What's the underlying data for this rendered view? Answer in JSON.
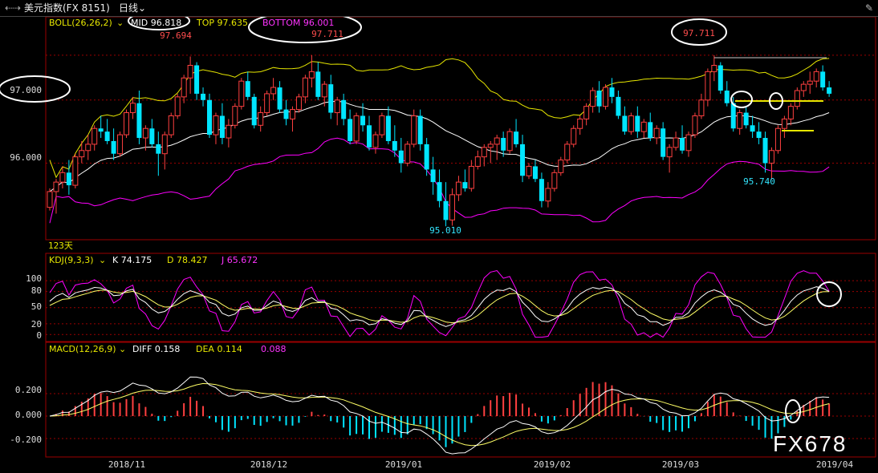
{
  "header": {
    "nav_icon": "back-forward-icon",
    "instrument": "美元指数(FX 8151)",
    "period": "日线",
    "gear_icon": "wrench-icon"
  },
  "price_panel": {
    "boll_label": "BOLL(26,26,2)",
    "mid_label": "MID 96.818",
    "top_label": "TOP 97.635",
    "bottom_label": "BOTTOM 96.001",
    "yticks": [
      "97.000",
      "96.000"
    ],
    "ann_left_high": "97.694",
    "ann_mid_high": "97.711",
    "ann_right_high": "97.711",
    "ann_low1": "95.010",
    "ann_low2": "95.740",
    "days_label": "123天"
  },
  "kdj_panel": {
    "label": "KDJ(9,3,3)",
    "k_label": "K 74.175",
    "d_label": "D 78.427",
    "j_label": "J 65.672",
    "yticks": [
      "100",
      "80",
      "50",
      "20",
      "0"
    ]
  },
  "macd_panel": {
    "label": "MACD(12,26,9)",
    "diff_label": "DIFF 0.158",
    "dea_label": "DEA 0.114",
    "hist_label": "0.088",
    "yticks": [
      "0.200",
      "0.000",
      "-0.200"
    ]
  },
  "x_axis": {
    "labels": [
      "2018/11",
      "2018/12",
      "2019/01",
      "2019/02",
      "2019/03",
      "2019/04"
    ]
  },
  "watermark": "FX678",
  "colors": {
    "up": "#ff4040",
    "down": "#00e5ff",
    "mid": "#ffffff",
    "top": "#e6e600",
    "bottom": "#ff00ff",
    "grid": "#800000",
    "kdj_k": "#ffffff",
    "kdj_d": "#ffff66",
    "kdj_j": "#ff00ff"
  },
  "chart_data": {
    "type": "candlestick",
    "title": "美元指数(FX 8151) 日线",
    "price_ylim": [
      94.8,
      97.95
    ],
    "candles": [
      [
        95.3,
        95.6,
        95.25,
        95.55
      ],
      [
        95.55,
        95.75,
        95.2,
        95.7
      ],
      [
        95.7,
        95.95,
        95.6,
        95.85
      ],
      [
        95.85,
        96.05,
        95.5,
        95.65
      ],
      [
        95.65,
        96.15,
        95.6,
        96.1
      ],
      [
        96.1,
        96.35,
        96.0,
        96.2
      ],
      [
        96.2,
        96.45,
        96.05,
        96.3
      ],
      [
        96.3,
        96.6,
        96.2,
        96.55
      ],
      [
        96.55,
        96.75,
        96.4,
        96.5
      ],
      [
        96.5,
        96.7,
        96.3,
        96.35
      ],
      [
        96.35,
        96.55,
        96.05,
        96.15
      ],
      [
        96.15,
        96.5,
        96.1,
        96.45
      ],
      [
        96.45,
        96.85,
        96.4,
        96.8
      ],
      [
        96.8,
        97.05,
        96.7,
        96.95
      ],
      [
        96.95,
        97.15,
        96.3,
        96.4
      ],
      [
        96.4,
        96.6,
        96.2,
        96.55
      ],
      [
        96.55,
        96.7,
        96.25,
        96.3
      ],
      [
        96.3,
        96.5,
        95.8,
        96.15
      ],
      [
        96.15,
        96.5,
        95.9,
        96.45
      ],
      [
        96.45,
        96.8,
        96.4,
        96.75
      ],
      [
        96.75,
        97.1,
        96.7,
        97.05
      ],
      [
        97.05,
        97.4,
        96.95,
        97.35
      ],
      [
        97.35,
        97.69,
        97.1,
        97.55
      ],
      [
        97.55,
        97.6,
        97.0,
        97.1
      ],
      [
        97.1,
        97.2,
        96.9,
        97.0
      ],
      [
        97.0,
        97.1,
        96.4,
        96.45
      ],
      [
        96.45,
        96.8,
        96.3,
        96.75
      ],
      [
        96.75,
        96.95,
        96.3,
        96.4
      ],
      [
        96.4,
        96.7,
        96.25,
        96.6
      ],
      [
        96.6,
        96.95,
        96.55,
        96.9
      ],
      [
        96.9,
        97.35,
        96.85,
        97.3
      ],
      [
        97.3,
        97.45,
        97.0,
        97.05
      ],
      [
        97.05,
        97.1,
        96.55,
        96.6
      ],
      [
        96.6,
        96.9,
        96.5,
        96.8
      ],
      [
        96.8,
        97.15,
        96.75,
        97.1
      ],
      [
        97.1,
        97.35,
        97.0,
        97.2
      ],
      [
        97.2,
        97.3,
        96.8,
        96.85
      ],
      [
        96.85,
        97.0,
        96.6,
        96.7
      ],
      [
        96.7,
        96.9,
        96.5,
        96.85
      ],
      [
        96.85,
        97.1,
        96.8,
        97.05
      ],
      [
        97.05,
        97.4,
        96.95,
        97.35
      ],
      [
        97.35,
        97.71,
        97.2,
        97.45
      ],
      [
        97.45,
        97.6,
        97.0,
        97.05
      ],
      [
        97.05,
        97.3,
        96.9,
        97.25
      ],
      [
        97.25,
        97.4,
        96.7,
        96.8
      ],
      [
        96.8,
        97.05,
        96.6,
        97.0
      ],
      [
        97.0,
        97.1,
        96.6,
        96.7
      ],
      [
        96.7,
        96.85,
        96.3,
        96.35
      ],
      [
        96.35,
        96.8,
        96.3,
        96.75
      ],
      [
        96.75,
        96.95,
        96.5,
        96.6
      ],
      [
        96.6,
        96.75,
        96.2,
        96.25
      ],
      [
        96.25,
        96.5,
        96.15,
        96.45
      ],
      [
        96.45,
        96.8,
        96.4,
        96.75
      ],
      [
        96.75,
        96.9,
        96.3,
        96.35
      ],
      [
        96.35,
        96.6,
        96.1,
        96.2
      ],
      [
        96.2,
        96.4,
        95.85,
        96.0
      ],
      [
        96.0,
        96.35,
        95.95,
        96.3
      ],
      [
        96.3,
        96.85,
        96.25,
        96.75
      ],
      [
        96.75,
        96.85,
        96.2,
        96.3
      ],
      [
        96.3,
        96.4,
        95.8,
        95.9
      ],
      [
        95.9,
        96.1,
        95.5,
        95.7
      ],
      [
        95.7,
        95.9,
        95.3,
        95.4
      ],
      [
        95.4,
        95.7,
        95.0,
        95.1
      ],
      [
        95.1,
        95.6,
        95.01,
        95.5
      ],
      [
        95.5,
        95.8,
        95.4,
        95.7
      ],
      [
        95.7,
        95.9,
        95.55,
        95.6
      ],
      [
        95.6,
        96.05,
        95.55,
        95.95
      ],
      [
        95.95,
        96.2,
        95.9,
        96.1
      ],
      [
        96.1,
        96.3,
        95.95,
        96.25
      ],
      [
        96.25,
        96.35,
        96.0,
        96.3
      ],
      [
        96.3,
        96.45,
        96.05,
        96.4
      ],
      [
        96.4,
        96.5,
        96.1,
        96.2
      ],
      [
        96.2,
        96.55,
        96.15,
        96.5
      ],
      [
        96.5,
        96.7,
        96.25,
        96.3
      ],
      [
        96.3,
        96.45,
        95.7,
        95.8
      ],
      [
        95.8,
        96.0,
        95.75,
        95.95
      ],
      [
        95.95,
        96.05,
        95.7,
        95.75
      ],
      [
        95.75,
        95.85,
        95.3,
        95.4
      ],
      [
        95.4,
        95.7,
        95.3,
        95.6
      ],
      [
        95.6,
        95.9,
        95.55,
        95.85
      ],
      [
        95.85,
        96.1,
        95.8,
        96.05
      ],
      [
        96.05,
        96.35,
        96.0,
        96.3
      ],
      [
        96.3,
        96.6,
        96.25,
        96.55
      ],
      [
        96.55,
        96.75,
        96.45,
        96.7
      ],
      [
        96.7,
        96.95,
        96.6,
        96.9
      ],
      [
        96.9,
        97.2,
        96.8,
        97.15
      ],
      [
        97.15,
        97.3,
        96.8,
        96.9
      ],
      [
        96.9,
        97.25,
        96.85,
        97.2
      ],
      [
        97.2,
        97.35,
        96.95,
        97.05
      ],
      [
        97.05,
        97.15,
        96.7,
        96.75
      ],
      [
        96.75,
        96.9,
        96.45,
        96.5
      ],
      [
        96.5,
        96.8,
        96.45,
        96.75
      ],
      [
        96.75,
        96.9,
        96.4,
        96.5
      ],
      [
        96.5,
        96.7,
        96.4,
        96.65
      ],
      [
        96.65,
        96.8,
        96.35,
        96.4
      ],
      [
        96.4,
        96.6,
        96.3,
        96.55
      ],
      [
        96.55,
        96.65,
        96.05,
        96.1
      ],
      [
        96.1,
        96.3,
        95.85,
        96.25
      ],
      [
        96.25,
        96.5,
        96.2,
        96.4
      ],
      [
        96.4,
        96.6,
        96.15,
        96.2
      ],
      [
        96.2,
        96.5,
        96.1,
        96.45
      ],
      [
        96.45,
        96.8,
        96.4,
        96.75
      ],
      [
        96.75,
        97.1,
        96.7,
        97.0
      ],
      [
        97.0,
        97.5,
        96.9,
        97.45
      ],
      [
        97.45,
        97.71,
        97.3,
        97.55
      ],
      [
        97.55,
        97.6,
        97.1,
        97.15
      ],
      [
        97.15,
        97.3,
        96.9,
        96.95
      ],
      [
        96.95,
        97.05,
        96.5,
        96.55
      ],
      [
        96.55,
        96.85,
        96.45,
        96.8
      ],
      [
        96.8,
        96.9,
        96.55,
        96.6
      ],
      [
        96.6,
        96.75,
        96.4,
        96.5
      ],
      [
        96.5,
        96.65,
        96.3,
        96.4
      ],
      [
        96.4,
        96.5,
        95.85,
        96.0
      ],
      [
        96.0,
        96.25,
        95.74,
        96.2
      ],
      [
        96.2,
        96.6,
        96.15,
        96.55
      ],
      [
        96.55,
        96.75,
        96.4,
        96.7
      ],
      [
        96.7,
        96.95,
        96.6,
        96.9
      ],
      [
        96.9,
        97.2,
        96.85,
        97.15
      ],
      [
        97.15,
        97.3,
        97.05,
        97.25
      ],
      [
        97.25,
        97.45,
        97.1,
        97.3
      ],
      [
        97.3,
        97.5,
        97.2,
        97.45
      ],
      [
        97.45,
        97.55,
        97.15,
        97.2
      ],
      [
        97.2,
        97.3,
        97.05,
        97.1
      ]
    ],
    "kdj_ylim": [
      -10,
      130
    ],
    "macd_ylim": [
      -0.35,
      0.55
    ]
  }
}
